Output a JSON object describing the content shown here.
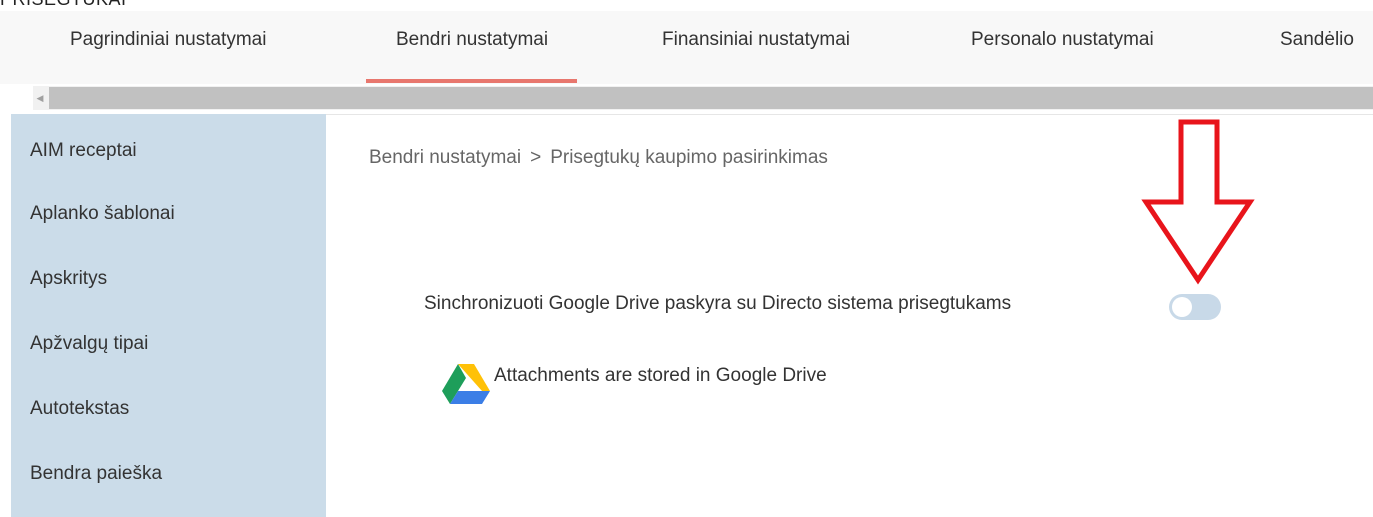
{
  "page_heading": "PRISEGTUKAI",
  "tabs": [
    {
      "label": "Pagrindiniai nustatymai",
      "active": false
    },
    {
      "label": "Bendri nustatymai",
      "active": true
    },
    {
      "label": "Finansiniai nustatymai",
      "active": false
    },
    {
      "label": "Personalo nustatymai",
      "active": false
    },
    {
      "label": "Sandėlio",
      "active": false
    }
  ],
  "accent_color": "#e8776e",
  "sidebar": {
    "items": [
      {
        "label": "AIM receptai"
      },
      {
        "label": "Aplanko šablonai"
      },
      {
        "label": "Apskritys"
      },
      {
        "label": "Apžvalgų tipai"
      },
      {
        "label": "Autotekstas"
      },
      {
        "label": "Bendra paieška"
      }
    ],
    "background": "#cbdce9"
  },
  "breadcrumb": {
    "parent": "Bendri nustatymai",
    "separator": ">",
    "current": "Prisegtukų kaupimo pasirinkimas"
  },
  "settings": {
    "sync_label": "Sinchronizuoti Google Drive paskyra su Directo sistema prisegtukams",
    "sync_enabled": false,
    "storage_note": "Attachments are stored in Google Drive",
    "storage_icon": "google-drive-icon"
  },
  "annotation": {
    "icon": "red-down-arrow",
    "color": "#e8141b"
  }
}
